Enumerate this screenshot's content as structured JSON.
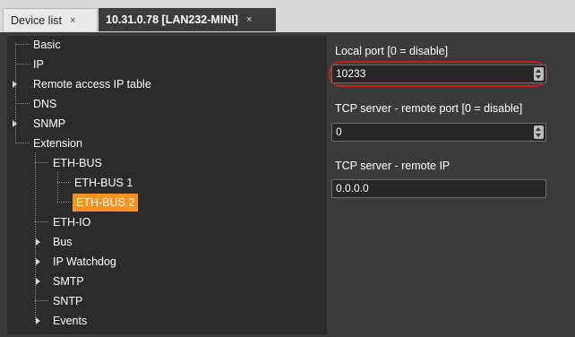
{
  "tabs": [
    {
      "label": "Device list",
      "close": "×"
    },
    {
      "label": "10.31.0.78 [LAN232-MINI]",
      "close": "×"
    }
  ],
  "tree": {
    "items": [
      {
        "label": "Basic"
      },
      {
        "label": "IP"
      },
      {
        "label": "Remote access IP table"
      },
      {
        "label": "DNS"
      },
      {
        "label": "SNMP"
      },
      {
        "label": "Extension"
      },
      {
        "label": "ETH-BUS"
      },
      {
        "label": "ETH-BUS 1"
      },
      {
        "label": "ETH-BUS 2"
      },
      {
        "label": "ETH-IO"
      },
      {
        "label": "Bus"
      },
      {
        "label": "IP Watchdog"
      },
      {
        "label": "SMTP"
      },
      {
        "label": "SNTP"
      },
      {
        "label": "Events"
      }
    ],
    "selected": "ETH-BUS 2",
    "selected_color": "#f7931e"
  },
  "form": {
    "local_port_label": "Local port [0 = disable]",
    "local_port_value": "10233",
    "tcp_remote_port_label": "TCP server - remote port [0 = disable]",
    "tcp_remote_port_value": "0",
    "tcp_remote_ip_label": "TCP server - remote IP",
    "tcp_remote_ip_value": "0.0.0.0"
  },
  "highlight_color": "#d11a1a"
}
